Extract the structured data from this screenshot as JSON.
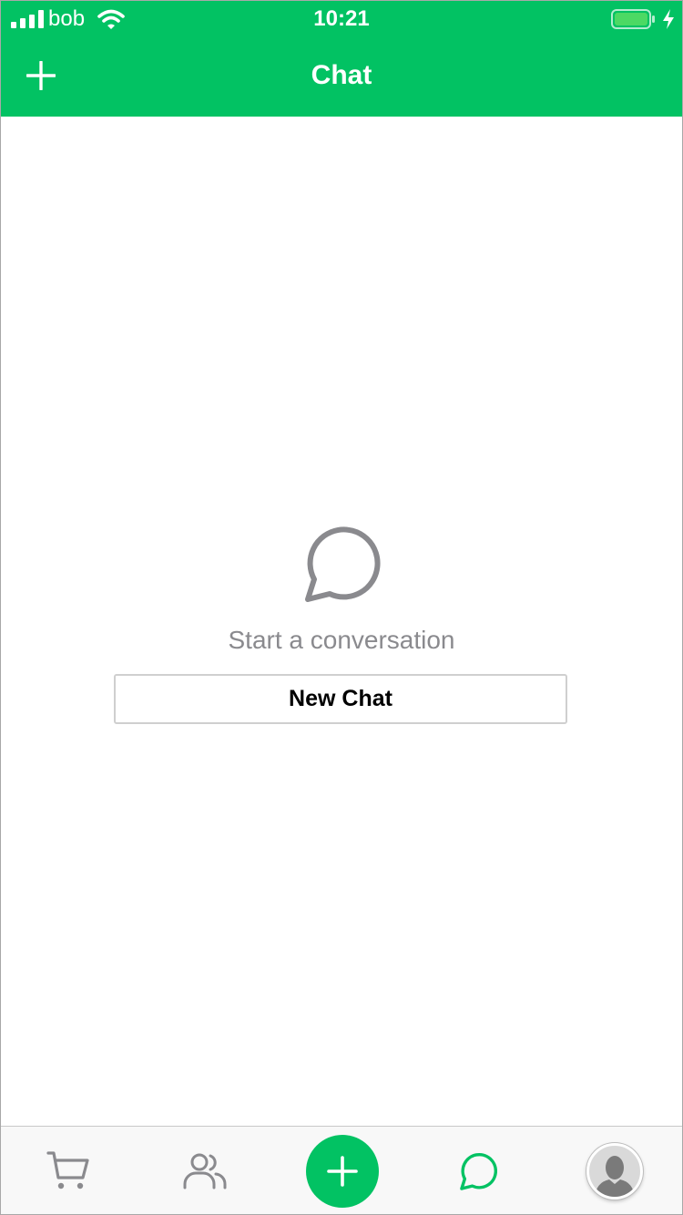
{
  "status_bar": {
    "carrier": "bob",
    "time": "10:21",
    "icons": [
      "signal-icon",
      "wifi-icon",
      "battery-icon",
      "charging-icon"
    ]
  },
  "header": {
    "title": "Chat",
    "left_action_icon": "plus-icon"
  },
  "empty_state": {
    "icon": "chat-bubble-icon",
    "message": "Start a conversation",
    "button_label": "New Chat"
  },
  "tab_bar": {
    "active_tab": "chat",
    "tabs": [
      {
        "id": "cart",
        "icon": "cart-icon"
      },
      {
        "id": "people",
        "icon": "people-icon"
      },
      {
        "id": "add",
        "icon": "plus-icon"
      },
      {
        "id": "chat",
        "icon": "chat-bubble-icon"
      },
      {
        "id": "profile",
        "icon": "avatar"
      }
    ]
  },
  "colors": {
    "brand_green": "#02c263",
    "inactive_icon": "#8a8a8e",
    "active_icon": "#02c263",
    "battery_fill": "#4cd964"
  }
}
